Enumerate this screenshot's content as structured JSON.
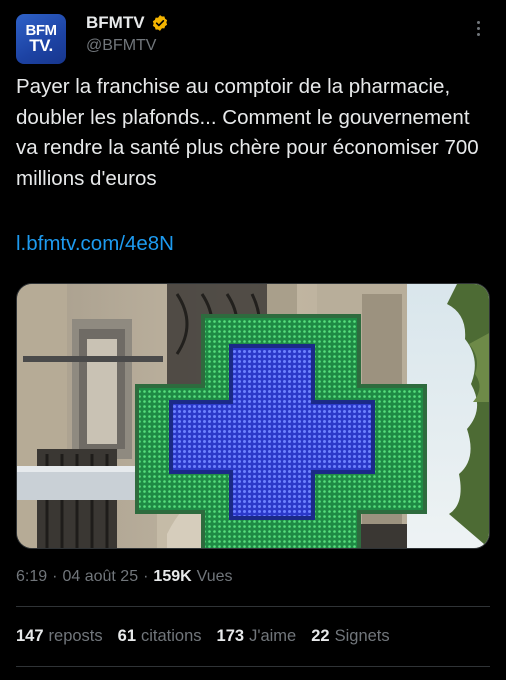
{
  "author": {
    "avatar_line1": "BFM",
    "avatar_line2": "TV.",
    "display_name": "BFMTV",
    "handle": "@BFMTV",
    "verified_color": "#f4b400"
  },
  "tweet": {
    "text": "Payer la franchise au comptoir de la pharmacie, doubler les plafonds... Comment le gouvernement va rendre la santé plus chère pour économiser 700 millions d'euros",
    "link": "l.bfmtv.com/4e8N",
    "image_icon": "pharmacy-cross"
  },
  "meta": {
    "time": "6:19",
    "sep1": "·",
    "date": "04 août 25",
    "sep2": "·",
    "views_count": "159K",
    "views_label": "Vues"
  },
  "stats": [
    {
      "count": "147",
      "label": "reposts"
    },
    {
      "count": "61",
      "label": "citations"
    },
    {
      "count": "173",
      "label": "J'aime"
    },
    {
      "count": "22",
      "label": "Signets"
    }
  ],
  "colors": {
    "background": "#000000",
    "text": "#e7e9ea",
    "muted": "#71767b",
    "link": "#1d9bf0"
  }
}
